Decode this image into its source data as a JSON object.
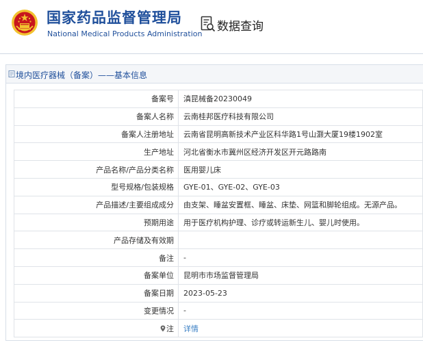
{
  "header": {
    "site_title_cn": "国家药品监督管理局",
    "site_title_en": "National Medical Products Administration",
    "query_title": "数据查询",
    "emblem_icon": "national-emblem-icon",
    "query_icon": "document-search-icon"
  },
  "panel": {
    "title": "境内医疗器械（备案）——基本信息",
    "title_icon": "document-icon"
  },
  "records": [
    {
      "label": "备案号",
      "value": "滇昆械备20230049"
    },
    {
      "label": "备案人名称",
      "value": "云南桂邦医疗科技有限公司"
    },
    {
      "label": "备案人注册地址",
      "value": "云南省昆明高新技术产业区科华路1号山灏大厦19楼1902室"
    },
    {
      "label": "生产地址",
      "value": "河北省衡水市冀州区经济开发区开元路路南"
    },
    {
      "label": "产品名称/产品分类名称",
      "value": "医用婴儿床"
    },
    {
      "label": "型号规格/包装规格",
      "value": "GYE-01、GYE-02、GYE-03"
    },
    {
      "label": "产品描述/主要组成成分",
      "value": "由支架、睡盆安置框、睡盆、床垫、网篮和脚轮组成。无源产品。"
    },
    {
      "label": "预期用途",
      "value": "用于医疗机构护理、诊疗或转运新生儿、婴儿时使用。"
    },
    {
      "label": "产品存储及有效期",
      "value": ""
    },
    {
      "label": "备注",
      "value": "-"
    },
    {
      "label": "备案单位",
      "value": "昆明市市场监督管理局"
    },
    {
      "label": "备案日期",
      "value": "2023-05-23"
    },
    {
      "label": "变更情况",
      "value": "-"
    }
  ],
  "note": {
    "label": "注",
    "link_text": "详情",
    "icon": "pin-icon"
  },
  "colors": {
    "brand_blue": "#1f4f9b",
    "emblem_red": "#c8161d",
    "emblem_gold": "#f2c230",
    "link_blue": "#3a7fc4"
  }
}
